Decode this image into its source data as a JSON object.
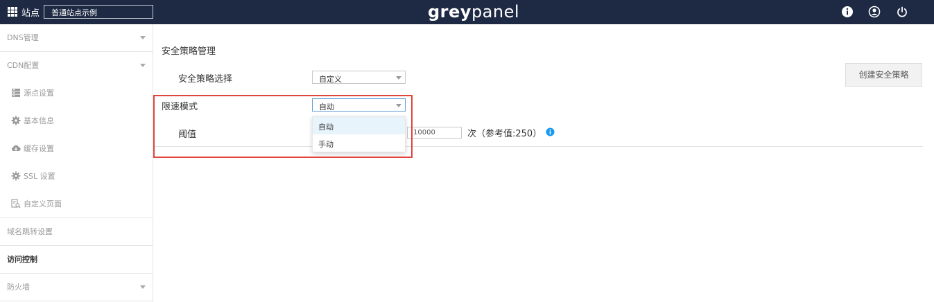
{
  "header": {
    "site_label": "站点",
    "site_select_value": "普通站点示例",
    "brand_part1": "grey",
    "brand_part2": "panel",
    "icons": [
      "info-icon",
      "user-icon",
      "power-icon"
    ]
  },
  "sidebar": {
    "items": [
      {
        "label": "DNS管理",
        "expandable": true
      },
      {
        "label": "CDN配置",
        "expandable": true
      },
      {
        "label": "源点设置",
        "icon": "server-icon"
      },
      {
        "label": "基本信息",
        "icon": "gear-icon"
      },
      {
        "label": "缓存设置",
        "icon": "cloud-download-icon"
      },
      {
        "label": "SSL 设置",
        "icon": "cog-icon"
      },
      {
        "label": "自定义页面",
        "icon": "page-search-icon"
      },
      {
        "label": "域名跳转设置"
      },
      {
        "label": "访问控制",
        "active": true
      },
      {
        "label": "防火墙",
        "expandable": true
      }
    ]
  },
  "main": {
    "section_title": "安全策略管理",
    "policy_label": "安全策略选择",
    "policy_value": "自定义",
    "create_button": "创建安全策略",
    "rate_mode_label": "限速模式",
    "rate_mode_value": "自动",
    "dropdown_options": [
      "自动",
      "手动"
    ],
    "threshold_label": "阈值",
    "threshold_value": "10000",
    "threshold_hint": "次（参考值:250）"
  },
  "colors": {
    "topbar": "#1e2a44",
    "highlight": "#e0453c",
    "info_blue": "#1a9bef",
    "dropdown_active": "#e8f4fc"
  }
}
